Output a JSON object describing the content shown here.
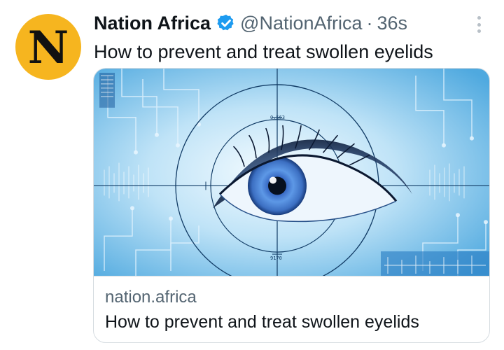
{
  "account": {
    "avatar_letter": "N",
    "display_name": "Nation Africa",
    "handle": "@NationAfrica",
    "separator": "·",
    "timestamp": "36s",
    "verified": true,
    "avatar_color": "#f6b51f",
    "verified_color": "#1d9bf0"
  },
  "tweet": {
    "text": "How to prevent and treat swollen eyelids"
  },
  "card": {
    "domain": "nation.africa",
    "title": "How to prevent and treat swollen eyelids",
    "image_readouts": {
      "top": "0.563",
      "bottom": "9170"
    }
  }
}
